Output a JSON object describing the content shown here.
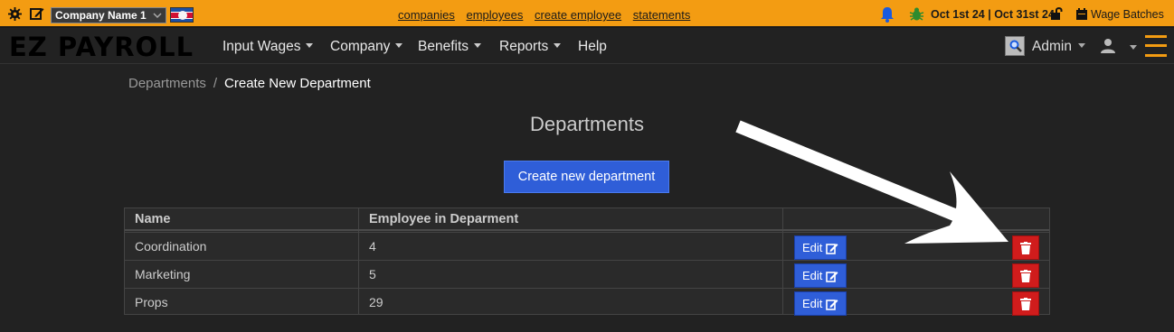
{
  "topbar": {
    "company_selected": "Company Name 1",
    "links": [
      "companies",
      "employees",
      "create employee",
      "statements"
    ],
    "period": "Oct 1st 24 | Oct 31st 24",
    "wage_batches": "Wage Batches",
    "accent_color": "#f39c12"
  },
  "navbar": {
    "brand": "EZ PAYROLL",
    "menu": [
      {
        "label": "Input Wages",
        "dropdown": true
      },
      {
        "label": "Company",
        "dropdown": true
      },
      {
        "label": "Benefits",
        "dropdown": true
      },
      {
        "label": "Reports",
        "dropdown": true
      },
      {
        "label": "Help",
        "dropdown": false
      }
    ],
    "admin_label": "Admin"
  },
  "breadcrumb": {
    "parent": "Departments",
    "separator": "/",
    "current": "Create New Department"
  },
  "page": {
    "title": "Departments",
    "create_button": "Create new department"
  },
  "table": {
    "headers": [
      "Name",
      "Employee in Deparment"
    ],
    "rows": [
      {
        "name": "Coordination",
        "count": "4"
      },
      {
        "name": "Marketing",
        "count": "5"
      },
      {
        "name": "Props",
        "count": "29"
      }
    ],
    "edit_label": "Edit",
    "edit_color": "#2f5ed8",
    "delete_color": "#d01c1c"
  }
}
